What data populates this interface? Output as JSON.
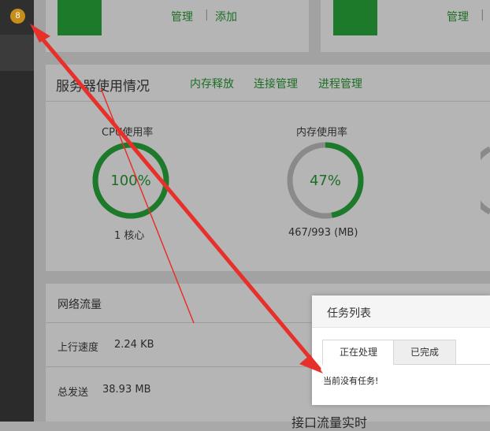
{
  "sidebar": {
    "badge": "8"
  },
  "top_cards": {
    "left": {
      "manage": "管理",
      "sep": "|",
      "add": "添加"
    },
    "right": {
      "manage": "管理",
      "sep": "|"
    }
  },
  "server_panel": {
    "title": "服务器使用情况",
    "links": [
      "内存释放",
      "连接管理",
      "进程管理"
    ],
    "cpu": {
      "label": "CPU使用率",
      "value": "100%",
      "percent": 100,
      "detail": "1 核心"
    },
    "memory": {
      "label": "内存使用率",
      "value": "47%",
      "percent": 47,
      "detail": "467/993 (MB)"
    }
  },
  "net_panel": {
    "title": "网络流量",
    "upload_label": "上行速度",
    "upload_value": "2.24 KB",
    "total_sent_label": "总发送",
    "total_sent_value": "38.93 MB",
    "partial_heading": "接口流量实时"
  },
  "task_modal": {
    "title": "任务列表",
    "tabs": [
      {
        "label": "正在处理",
        "active": true
      },
      {
        "label": "已完成",
        "active": false
      }
    ],
    "empty_text": "当前没有任务!"
  },
  "colors": {
    "accent": "#1d7a2a",
    "badge": "#c78f1a",
    "arrow": "#e8302a"
  }
}
